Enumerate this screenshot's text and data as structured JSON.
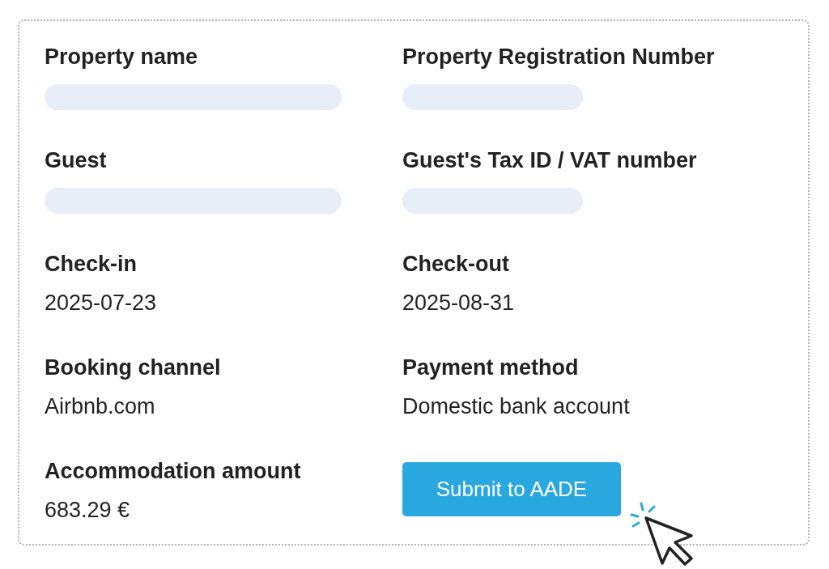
{
  "fields": [
    {
      "label": "Property name",
      "kind": "redacted"
    },
    {
      "label": "Property Registration Number",
      "kind": "redacted"
    },
    {
      "label": "Guest",
      "kind": "redacted"
    },
    {
      "label": "Guest's Tax ID / VAT number",
      "kind": "redacted"
    },
    {
      "label": "Check-in",
      "kind": "text",
      "value": "2025-07-23"
    },
    {
      "label": "Check-out",
      "kind": "text",
      "value": "2025-08-31"
    },
    {
      "label": "Booking channel",
      "kind": "text",
      "value": "Airbnb.com"
    },
    {
      "label": "Payment method",
      "kind": "text",
      "value": "Domestic bank account"
    },
    {
      "label": "Accommodation amount",
      "kind": "text",
      "value": "683.29 €"
    }
  ],
  "button": {
    "label": "Submit to AADE"
  }
}
